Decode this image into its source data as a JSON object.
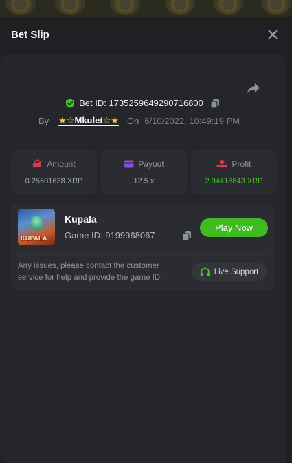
{
  "modal": {
    "title": "Bet Slip"
  },
  "bet": {
    "id_label": "Bet ID: 1735259649290716800",
    "by_label": "By",
    "user_stars_left": "★☆",
    "username": "Mkulet",
    "user_stars_right": "☆★",
    "on_label": "On",
    "date": "6/10/2022, 10:49:19 PM"
  },
  "stats": [
    {
      "label": "Amount",
      "value": "0.25601638 XRP",
      "icon": "wallet-out-icon"
    },
    {
      "label": "Payout",
      "value": "12.5 x",
      "icon": "card-icon"
    },
    {
      "label": "Profit",
      "value": "2.94418843 XRP",
      "icon": "hand-coin-icon"
    }
  ],
  "game": {
    "thumb_text": "KUPALA",
    "name": "Kupala",
    "id_label": "Game ID: 9199968067",
    "play_label": "Play Now",
    "help_text": "Any issues, please contact the customer service for help and provide the game ID.",
    "support_label": "Live Support"
  },
  "colors": {
    "accent_green": "#3dbb1f",
    "profit_green": "#3fc42a",
    "icon_red": "#e0384e",
    "icon_purple": "#8a4de0",
    "star_gold": "#f4c542"
  }
}
